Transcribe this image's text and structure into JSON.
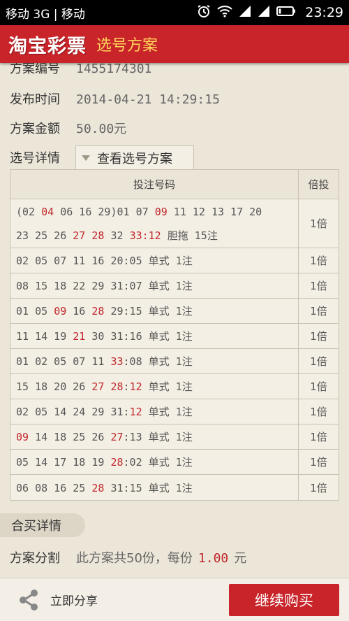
{
  "status_bar": {
    "carrier": "移动 3G | 移动",
    "time": "23:29",
    "icons": [
      "alarm-icon",
      "wifi-icon",
      "signal-icon",
      "signal-icon",
      "battery-icon"
    ]
  },
  "header": {
    "logo": "淘宝彩票",
    "title": "选号方案"
  },
  "info": {
    "plan_no_label": "方案编号",
    "plan_no": "1455174301",
    "publish_label": "发布时间",
    "publish_time": "2014-04-21 14:29:15",
    "amount_label": "方案金额",
    "amount": "50.00元"
  },
  "detail": {
    "label": "选号详情",
    "view_button": "查看选号方案"
  },
  "table": {
    "headers": [
      "投注号码",
      "倍投"
    ],
    "rows": [
      {
        "lines": [
          [
            [
              "(02 ",
              "n"
            ],
            [
              "04",
              "r"
            ],
            [
              " 06 16 29)01 07 ",
              "n"
            ],
            [
              "09",
              "r"
            ],
            [
              " 11 12 13 17 20",
              "n"
            ]
          ],
          [
            [
              "23 25 26 ",
              "n"
            ],
            [
              "27 28",
              "r"
            ],
            [
              " 32 ",
              "n"
            ],
            [
              "33:12",
              "r"
            ],
            [
              " 胆拖 15注",
              "n"
            ]
          ]
        ],
        "mult": "1倍"
      },
      {
        "lines": [
          [
            [
              "02 05 07 11 16 20:05 单式 1注",
              "n"
            ]
          ]
        ],
        "mult": "1倍"
      },
      {
        "lines": [
          [
            [
              "08 15 18 22 29 31:07 单式 1注",
              "n"
            ]
          ]
        ],
        "mult": "1倍"
      },
      {
        "lines": [
          [
            [
              "01 05 ",
              "n"
            ],
            [
              "09",
              "r"
            ],
            [
              " 16 ",
              "n"
            ],
            [
              "28",
              "r"
            ],
            [
              " 29:15 单式 1注",
              "n"
            ]
          ]
        ],
        "mult": "1倍"
      },
      {
        "lines": [
          [
            [
              "11 14 19 ",
              "n"
            ],
            [
              "21",
              "r"
            ],
            [
              " 30 31:16 单式 1注",
              "n"
            ]
          ]
        ],
        "mult": "1倍"
      },
      {
        "lines": [
          [
            [
              "01 02 05 07 11 ",
              "n"
            ],
            [
              "33",
              "r"
            ],
            [
              ":08 单式 1注",
              "n"
            ]
          ]
        ],
        "mult": "1倍"
      },
      {
        "lines": [
          [
            [
              "15 18 20 26 ",
              "n"
            ],
            [
              "27 28",
              "r"
            ],
            [
              ":",
              "n"
            ],
            [
              "12",
              "r"
            ],
            [
              " 单式 1注",
              "n"
            ]
          ]
        ],
        "mult": "1倍"
      },
      {
        "lines": [
          [
            [
              "02 05 14 24 29 31:",
              "n"
            ],
            [
              "12",
              "r"
            ],
            [
              " 单式 1注",
              "n"
            ]
          ]
        ],
        "mult": "1倍"
      },
      {
        "lines": [
          [
            [
              "09",
              "r"
            ],
            [
              " 14 18 25 26 ",
              "n"
            ],
            [
              "27",
              "r"
            ],
            [
              ":13 单式 1注",
              "n"
            ]
          ]
        ],
        "mult": "1倍"
      },
      {
        "lines": [
          [
            [
              "05 14 17 18 19 ",
              "n"
            ],
            [
              "28",
              "r"
            ],
            [
              ":02 单式 1注",
              "n"
            ]
          ]
        ],
        "mult": "1倍"
      },
      {
        "lines": [
          [
            [
              "06 08 16 25 ",
              "n"
            ],
            [
              "28",
              "r"
            ],
            [
              " 31:15 单式 1注",
              "n"
            ]
          ]
        ],
        "mult": "1倍"
      }
    ]
  },
  "group_buy": {
    "tab": "合买详情",
    "split_label": "方案分割",
    "split_text_1": "此方案共50份，每份",
    "split_amount": "1.00",
    "split_unit": "元"
  },
  "footer": {
    "share": "立即分享",
    "buy": "继续购买"
  },
  "colors": {
    "brand_red": "#c8242a",
    "title_yellow": "#ffd35a",
    "number_red": "#c0272d",
    "background": "#ece6d9"
  }
}
